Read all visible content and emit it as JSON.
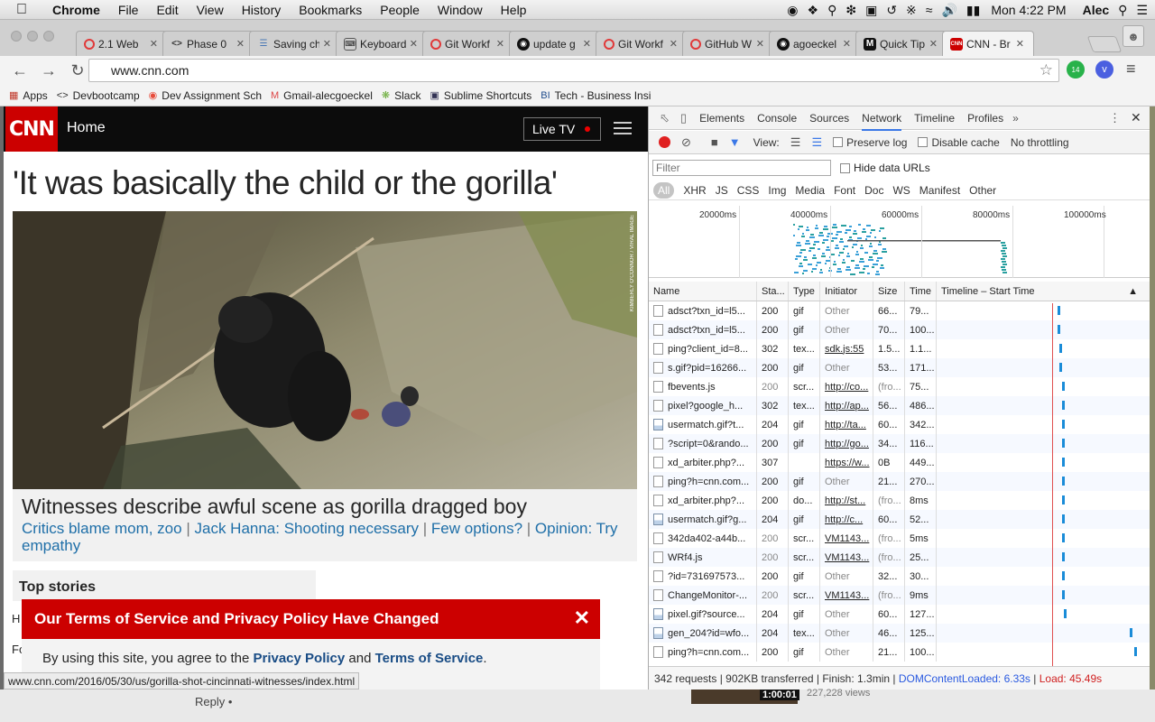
{
  "menubar": {
    "app_name": "Chrome",
    "menus": [
      "File",
      "Edit",
      "View",
      "History",
      "Bookmarks",
      "People",
      "Window",
      "Help"
    ],
    "clock": "Mon 4:22 PM",
    "user": "Alec"
  },
  "tabs": [
    {
      "title": "2.1 Web",
      "icon": "red-circle"
    },
    {
      "title": "Phase 0",
      "icon": "code"
    },
    {
      "title": "Saving ch",
      "icon": "database"
    },
    {
      "title": "Keyboard",
      "icon": "keyboard"
    },
    {
      "title": "Git Workf",
      "icon": "red-circle"
    },
    {
      "title": "update g",
      "icon": "github"
    },
    {
      "title": "Git Workf",
      "icon": "red-circle"
    },
    {
      "title": "GitHub W",
      "icon": "red-circle"
    },
    {
      "title": "agoeckel",
      "icon": "github"
    },
    {
      "title": "Quick Tip",
      "icon": "m"
    },
    {
      "title": "CNN - Br",
      "icon": "cnn"
    }
  ],
  "toolbar": {
    "url": "www.cnn.com",
    "ext_badge": "14"
  },
  "bookmarks": [
    {
      "label": "Apps"
    },
    {
      "label": "Devbootcamp"
    },
    {
      "label": "Dev Assignment Sch"
    },
    {
      "label": "Gmail-alecgoeckel"
    },
    {
      "label": "Slack"
    },
    {
      "label": "Sublime Shortcuts"
    },
    {
      "label": "Tech - Business Insi"
    }
  ],
  "cnn": {
    "logo": "CNN",
    "home": "Home",
    "live_tv": "Live TV",
    "headline": "'It was basically the child or the gorilla'",
    "photo_credit": "KIMBERLY O'CONNOR / VIRAL IMAGE",
    "caption_title": "Witnesses describe awful scene as gorilla dragged boy",
    "caption_links": [
      "Critics blame mom, zoo",
      "Jack Hanna: Shooting necessary",
      "Few options?",
      "Opinion: Try empathy"
    ],
    "top_stories": "Top stories",
    "stub_h": "H",
    "stub_f": "Fo",
    "tos_title": "Our Terms of Service and Privacy Policy Have Changed",
    "tos_pre": "By using this site, you agree to the",
    "tos_privacy": "Privacy Policy",
    "tos_and": "and",
    "tos_terms": "Terms of Service",
    "tos_end": "."
  },
  "status_url": "www.cnn.com/2016/05/30/us/gorilla-shot-cincinnati-witnesses/index.html",
  "devtools": {
    "panels": [
      "Elements",
      "Console",
      "Sources",
      "Network",
      "Timeline",
      "Profiles"
    ],
    "active_panel": "Network",
    "view_label": "View:",
    "preserve_log": "Preserve log",
    "disable_cache": "Disable cache",
    "throttling": "No throttling",
    "filter_placeholder": "Filter",
    "hide_data_urls": "Hide data URLs",
    "types": [
      "All",
      "XHR",
      "JS",
      "CSS",
      "Img",
      "Media",
      "Font",
      "Doc",
      "WS",
      "Manifest",
      "Other"
    ],
    "overview_ticks": [
      "20000ms",
      "40000ms",
      "60000ms",
      "80000ms",
      "100000ms"
    ],
    "columns": [
      "Name",
      "Sta...",
      "Type",
      "Initiator",
      "Size",
      "Time",
      "Timeline – Start Time"
    ],
    "rows": [
      {
        "name": "adsct?txn_id=l5...",
        "status": "200",
        "type": "gif",
        "initiator": "Other",
        "size": "66...",
        "time": "79...",
        "bar": 0.57,
        "img": false
      },
      {
        "name": "adsct?txn_id=l5...",
        "status": "200",
        "type": "gif",
        "initiator": "Other",
        "size": "70...",
        "time": "100...",
        "bar": 0.57,
        "img": false
      },
      {
        "name": "ping?client_id=8...",
        "status": "302",
        "type": "tex...",
        "initiator": "sdk.js:55",
        "size": "1.5...",
        "time": "1.1...",
        "bar": 0.58,
        "img": false
      },
      {
        "name": "s.gif?pid=16266...",
        "status": "200",
        "type": "gif",
        "initiator": "Other",
        "size": "53...",
        "time": "171...",
        "bar": 0.58,
        "img": false
      },
      {
        "name": "fbevents.js",
        "status": "200",
        "type": "scr...",
        "initiator": "http://co...",
        "size": "(fro...",
        "time": "75...",
        "bar": 0.59,
        "img": false
      },
      {
        "name": "pixel?google_h...",
        "status": "302",
        "type": "tex...",
        "initiator": "http://ap...",
        "size": "56...",
        "time": "486...",
        "bar": 0.59,
        "img": false
      },
      {
        "name": "usermatch.gif?t...",
        "status": "204",
        "type": "gif",
        "initiator": "http://ta...",
        "size": "60...",
        "time": "342...",
        "bar": 0.59,
        "img": true
      },
      {
        "name": "?script=0&rando...",
        "status": "200",
        "type": "gif",
        "initiator": "http://go...",
        "size": "34...",
        "time": "116...",
        "bar": 0.59,
        "img": false
      },
      {
        "name": "xd_arbiter.php?...",
        "status": "307",
        "type": "",
        "initiator": "https://w...",
        "size": "0B",
        "time": "449...",
        "bar": 0.59,
        "img": false
      },
      {
        "name": "ping?h=cnn.com...",
        "status": "200",
        "type": "gif",
        "initiator": "Other",
        "size": "21...",
        "time": "270...",
        "bar": 0.59,
        "img": false
      },
      {
        "name": "xd_arbiter.php?...",
        "status": "200",
        "type": "do...",
        "initiator": "http://st...",
        "size": "(fro...",
        "time": "8ms",
        "bar": 0.59,
        "img": false
      },
      {
        "name": "usermatch.gif?g...",
        "status": "204",
        "type": "gif",
        "initiator": "http://c...",
        "size": "60...",
        "time": "52...",
        "bar": 0.59,
        "img": true
      },
      {
        "name": "342da402-a44b...",
        "status": "200",
        "type": "scr...",
        "initiator": "VM1143...",
        "size": "(fro...",
        "time": "5ms",
        "bar": 0.59,
        "img": false
      },
      {
        "name": "WRf4.js",
        "status": "200",
        "type": "scr...",
        "initiator": "VM1143...",
        "size": "(fro...",
        "time": "25...",
        "bar": 0.59,
        "img": false
      },
      {
        "name": "?id=731697573...",
        "status": "200",
        "type": "gif",
        "initiator": "Other",
        "size": "32...",
        "time": "30...",
        "bar": 0.59,
        "img": false
      },
      {
        "name": "ChangeMonitor-...",
        "status": "200",
        "type": "scr...",
        "initiator": "VM1143...",
        "size": "(fro...",
        "time": "9ms",
        "bar": 0.59,
        "img": false
      },
      {
        "name": "pixel.gif?source...",
        "status": "204",
        "type": "gif",
        "initiator": "Other",
        "size": "60...",
        "time": "127...",
        "bar": 0.6,
        "img": true
      },
      {
        "name": "gen_204?id=wfo...",
        "status": "204",
        "type": "tex...",
        "initiator": "Other",
        "size": "46...",
        "time": "125...",
        "bar": 0.91,
        "img": true
      },
      {
        "name": "ping?h=cnn.com...",
        "status": "200",
        "type": "gif",
        "initiator": "Other",
        "size": "21...",
        "time": "100...",
        "bar": 0.93,
        "img": false
      }
    ],
    "status_summary": "342 requests | 902KB transferred | Finish: 1.3min |",
    "dom_content_loaded": "DOMContentLoaded: 6.33s",
    "load": "Load: 45.49s"
  },
  "behind": {
    "reply": "Reply •",
    "duration": "1:00:01",
    "views": "227,228 views"
  }
}
